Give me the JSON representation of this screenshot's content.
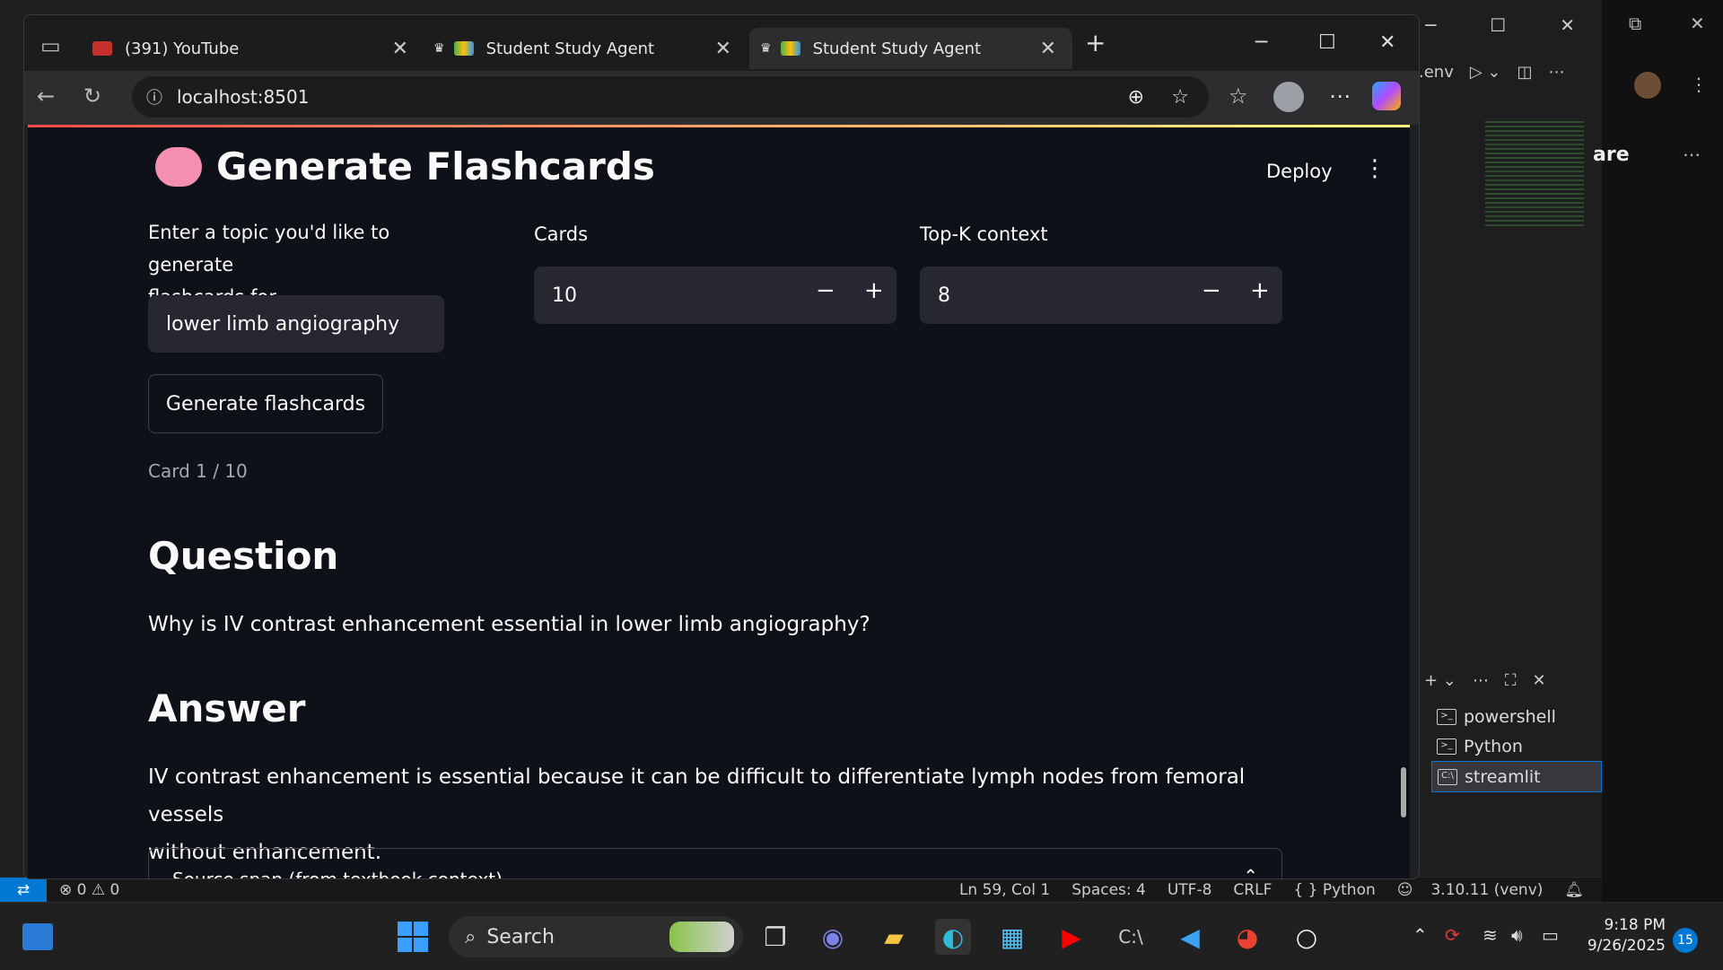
{
  "browser": {
    "tabs": [
      {
        "label": "(391) YouTube"
      },
      {
        "label": "Student Study Agent"
      },
      {
        "label": "Student Study Agent"
      }
    ],
    "url": "localhost:8501"
  },
  "app": {
    "title": "Generate Flashcards",
    "deploy_label": "Deploy",
    "topic": {
      "label_line1": "Enter a topic you'd like to generate",
      "label_line2": "flashcards for",
      "value": "lower limb angiography"
    },
    "cards": {
      "label": "Cards",
      "value": "10"
    },
    "topk": {
      "label": "Top-K context",
      "value": "8"
    },
    "generate_button": "Generate flashcards",
    "card_counter": "Card 1 / 10",
    "question_heading": "Question",
    "question": "Why is IV contrast enhancement essential in lower limb angiography?",
    "answer_heading": "Answer",
    "answer_line1": "IV contrast enhancement is essential because it can be difficult to differentiate lymph nodes from femoral vessels",
    "answer_line2": "without enhancement.",
    "expander_label": "Source span (from textbook context)"
  },
  "vscode": {
    "env_label": ".env",
    "terminals": [
      "powershell",
      "Python",
      "streamlit"
    ],
    "status": {
      "errors": "0",
      "warnings": "0",
      "position": "Ln 59, Col 1",
      "spaces": "Spaces: 4",
      "encoding": "UTF-8",
      "eol": "CRLF",
      "language": "Python",
      "interpreter": "3.10.11 (venv)"
    }
  },
  "right_window": {
    "partial_text": "are"
  },
  "taskbar": {
    "search_label": "Search",
    "time": "9:18 PM",
    "date": "9/26/2025",
    "notification_count": "15"
  },
  "colors": {
    "page_bg": "#0e1117",
    "input_bg": "#262730",
    "accent_blue": "#0078d4"
  }
}
